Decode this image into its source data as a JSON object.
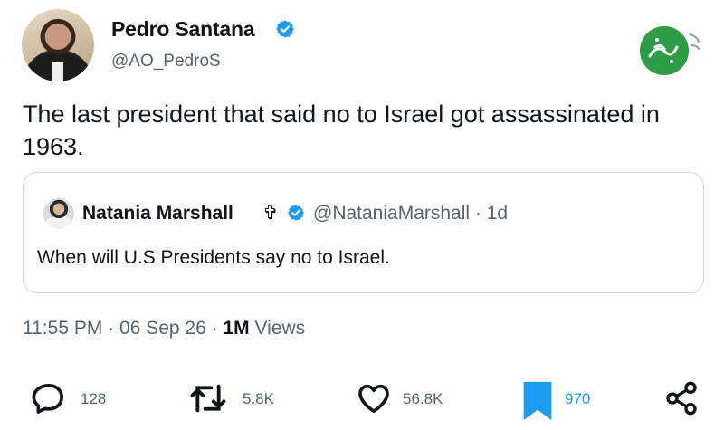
{
  "tweet": {
    "author": {
      "name": "Pedro Santana",
      "handle": "@AO_PedroS",
      "verified": true
    },
    "text": "The last president that said no to Israel got assassinated in 1963.",
    "quoted": {
      "name": "Natania Marshall",
      "name_symbol": "✞",
      "handle_time": "@NataniaMarshall · 1d",
      "text": "When will U.S Presidents say no to Israel."
    },
    "meta": {
      "time": "11:55 PM",
      "separator": "·",
      "date": "06 Sep 26",
      "views_count": "1M",
      "views_label": "Views"
    },
    "actions": {
      "replies": "128",
      "reposts": "5.8K",
      "likes": "56.8K",
      "bookmarks": "970"
    }
  },
  "colors": {
    "accent": "#1d9bf0",
    "secondary_text": "#536471",
    "primary_text": "#0f1419",
    "border": "#cfd9de",
    "watermark": "#2e9b47"
  },
  "icons": [
    "verified-badge-icon",
    "reply-icon",
    "repost-icon",
    "like-icon",
    "bookmark-icon",
    "share-icon",
    "watermark-logo-icon"
  ]
}
